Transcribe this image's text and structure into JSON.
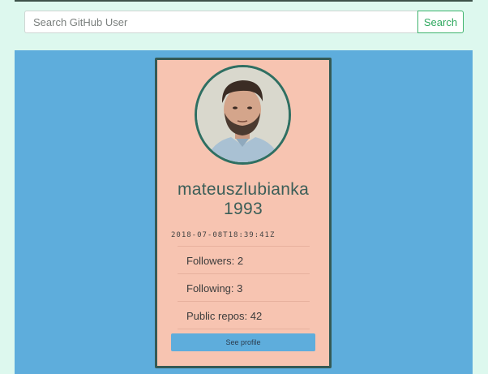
{
  "search": {
    "placeholder": "Search GitHub User",
    "value": "",
    "button_label": "Search"
  },
  "profile": {
    "username_line1": "mateuszlubianka",
    "username_line2": "1993",
    "created_at": "2018-07-08T18:39:41Z",
    "stats": [
      {
        "label": "Followers: 2"
      },
      {
        "label": "Following: 3"
      },
      {
        "label": "Public repos: 42"
      }
    ],
    "see_profile_label": "See profile"
  },
  "colors": {
    "page_background": "#ddf8ee",
    "content_background": "#5eaddc",
    "card_background": "#f7c4b1",
    "card_border": "#355a55",
    "search_button_accent": "#2fa85f",
    "profile_button": "#5eaddc"
  }
}
